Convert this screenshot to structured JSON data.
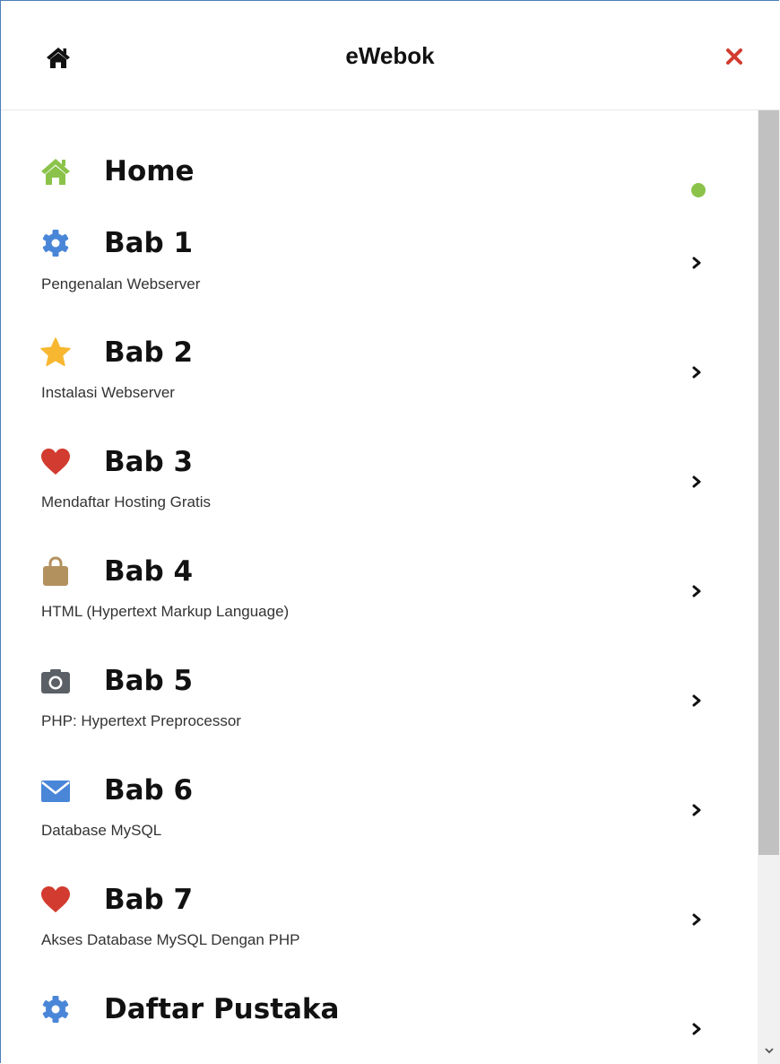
{
  "header": {
    "title": "eWebok",
    "home_icon": "home-icon",
    "close_icon": "close-icon",
    "close_color": "#d23b2f"
  },
  "menu": {
    "items": [
      {
        "label": "Home",
        "subtitle": "",
        "icon": "home-icon",
        "icon_color": "#8bc34a",
        "indicator": "green-dot"
      },
      {
        "label": "Bab 1",
        "subtitle": "Pengenalan Webserver",
        "icon": "gear-icon",
        "icon_color": "#4a86d8",
        "indicator": "chevron-right"
      },
      {
        "label": "Bab 2",
        "subtitle": "Instalasi Webserver",
        "icon": "star-icon",
        "icon_color": "#f7b731",
        "indicator": "chevron-right"
      },
      {
        "label": "Bab 3",
        "subtitle": "Mendaftar Hosting Gratis",
        "icon": "heart-icon",
        "icon_color": "#d23b2f",
        "indicator": "chevron-right"
      },
      {
        "label": "Bab 4",
        "subtitle": "HTML (Hypertext Markup Language)",
        "icon": "shopping-bag-icon",
        "icon_color": "#b3915f",
        "indicator": "chevron-right"
      },
      {
        "label": "Bab 5",
        "subtitle": "PHP: Hypertext Preprocessor",
        "icon": "camera-icon",
        "icon_color": "#5b6066",
        "indicator": "chevron-right"
      },
      {
        "label": "Bab 6",
        "subtitle": "Database MySQL",
        "icon": "envelope-icon",
        "icon_color": "#4a86d8",
        "indicator": "chevron-right"
      },
      {
        "label": "Bab 7",
        "subtitle": "Akses Database MySQL Dengan PHP",
        "icon": "heart-icon",
        "icon_color": "#d23b2f",
        "indicator": "chevron-right"
      },
      {
        "label": "Daftar Pustaka",
        "subtitle": "",
        "icon": "gear-icon",
        "icon_color": "#4a86d8",
        "indicator": "chevron-right"
      }
    ]
  },
  "colors": {
    "active_indicator": "#8bc34a",
    "border": "#4d7fb8",
    "scrollbar_thumb": "#c1c1c1"
  }
}
